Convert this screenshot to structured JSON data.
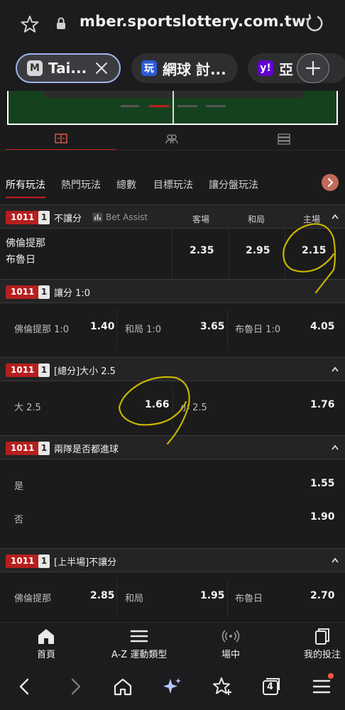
{
  "browser": {
    "url": "mber.sportslottery.com.tw",
    "tabs": [
      {
        "label": "Tai...",
        "favicon": "M"
      },
      {
        "label": "網球 討...",
        "favicon": "玩"
      },
      {
        "label": "亞",
        "favicon": "y!"
      }
    ]
  },
  "categories": [
    "所有玩法",
    "熱門玩法",
    "總數",
    "目標玩法",
    "讓分盤玩法"
  ],
  "markets": [
    {
      "code": "1011",
      "num": "1",
      "title": "不讓分",
      "bet_assist": "Bet Assist",
      "headers": [
        "客場",
        "和局",
        "主場"
      ],
      "team1": "佛倫提那",
      "team2": "布魯日",
      "odds": [
        "2.35",
        "2.95",
        "2.15"
      ]
    },
    {
      "code": "1011",
      "num": "1",
      "title": "讓分 1:0",
      "options": [
        {
          "label": "佛倫提那 1:0",
          "odd": "1.40"
        },
        {
          "label": "和局 1:0",
          "odd": "3.65"
        },
        {
          "label": "布魯日 1:0",
          "odd": "4.05"
        }
      ]
    },
    {
      "code": "1011",
      "num": "1",
      "title": "[總分]大小 2.5",
      "options": [
        {
          "label": "大 2.5",
          "odd": "1.66"
        },
        {
          "label": "小 2.5",
          "odd": "1.76"
        }
      ]
    },
    {
      "code": "1011",
      "num": "1",
      "title": "兩隊是否都進球",
      "options": [
        {
          "label": "是",
          "odd": "1.55"
        },
        {
          "label": "否",
          "odd": "1.90"
        }
      ]
    },
    {
      "code": "1011",
      "num": "1",
      "title": "[上半場]不讓分",
      "options": [
        {
          "label": "佛倫提那",
          "odd": "2.85"
        },
        {
          "label": "和局",
          "odd": "1.95"
        },
        {
          "label": "布魯日",
          "odd": "2.70"
        }
      ]
    }
  ],
  "app_nav": [
    "首頁",
    "A-Z 運動類型",
    "場中",
    "我的投注"
  ],
  "browser_nav": {
    "tab_count": "4"
  },
  "colors": {
    "accent": "#c21f1f",
    "code_badge": "#b51f1f",
    "annotation": "#c8b400"
  }
}
